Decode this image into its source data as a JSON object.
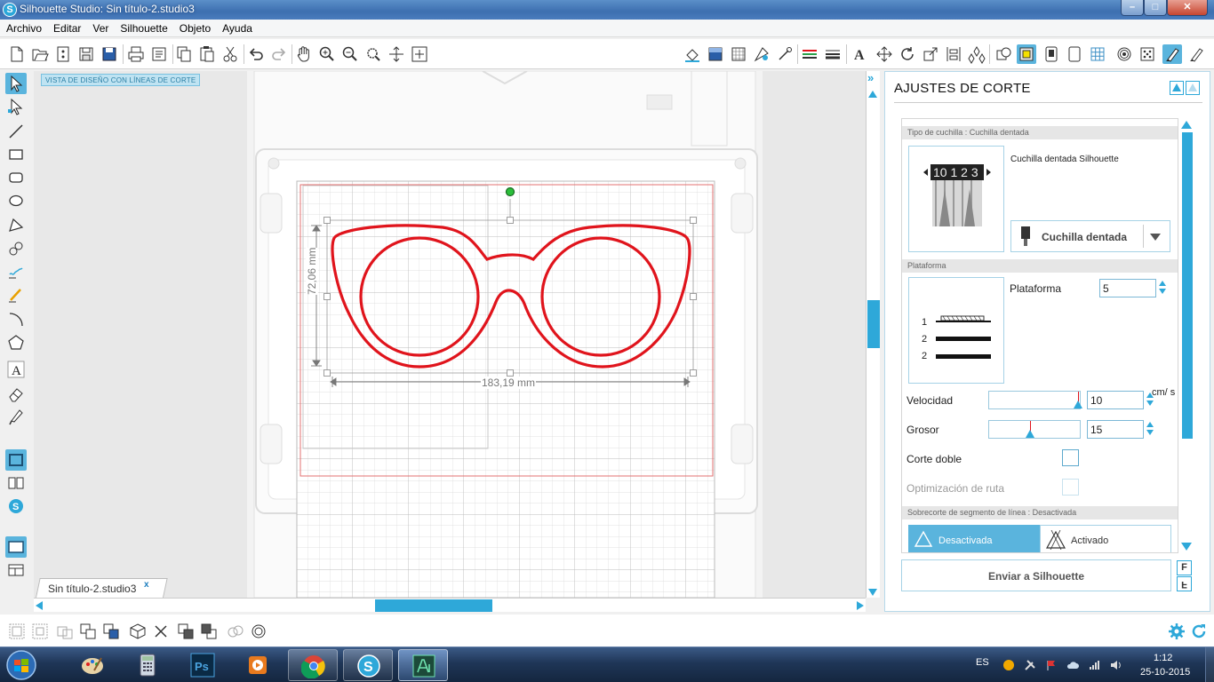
{
  "window": {
    "title": "Silhouette Studio: Sin título-2.studio3",
    "app_icon": "S"
  },
  "menu": [
    "Archivo",
    "Editar",
    "Ver",
    "Silhouette",
    "Objeto",
    "Ayuda"
  ],
  "canvas": {
    "view_label": "VISTA DE DISEÑO  CON LÍNEAS DE CORTE",
    "height_dimension": "72,06 mm",
    "width_dimension": "183,19 mm",
    "shape_color": "#e0141c"
  },
  "document_tab": {
    "label": "Sin título-2.studio3",
    "close": "x"
  },
  "panel": {
    "title": "AJUSTES DE CORTE",
    "blade_section": "Tipo de cuchilla : Cuchilla dentada",
    "blade_name": "Cuchilla dentada Silhouette",
    "blade_dial_text": "10 1 2 3",
    "blade_select": "Cuchilla dentada",
    "platform_section": "Plataforma",
    "platform_label": "Plataforma",
    "platform_value": "5",
    "platform_legend": [
      "1",
      "2",
      "2"
    ],
    "speed_label": "Velocidad",
    "speed_value": "10",
    "speed_unit": "cm/ s",
    "thickness_label": "Grosor",
    "thickness_value": "15",
    "double_cut_label": "Corte doble",
    "route_opt_label": "Optimización de ruta",
    "overcut_section": "Sobrecorte de segmento de línea : Desactivada",
    "overcut_off": "Desactivada",
    "overcut_on": "Activado",
    "send_button": "Enviar a Silhouette",
    "f_buttons": [
      "F",
      "F"
    ]
  },
  "taskbar": {
    "lang": "ES",
    "time": "1:12",
    "date": "25-10-2015",
    "apps": [
      "paint-icon",
      "calculator-icon",
      "photoshop-icon",
      "media-player-icon",
      "chrome-icon",
      "silhouette-icon",
      "illustrator-icon"
    ],
    "photoshop_label": "Ps"
  },
  "colors": {
    "accent": "#2ea8d9",
    "cut_line": "#e0141c"
  }
}
